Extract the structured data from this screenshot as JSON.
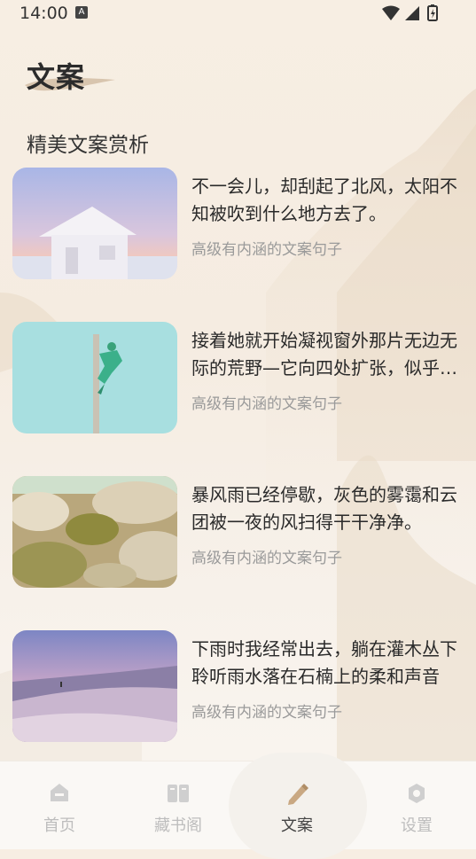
{
  "status_bar": {
    "time": "14:00"
  },
  "header": {
    "title": "文案"
  },
  "section": {
    "heading": "精美文案赏析"
  },
  "items": [
    {
      "title": "不一会儿，却刮起了北风，太阳不知被吹到什么地方去了。",
      "subtitle": "高级有内涵的文案句子",
      "image": "frozen-house-photo"
    },
    {
      "title": "接着她就开始凝视窗外那片无边无际的荒野—它向四处扩张，似乎无穷无尽",
      "subtitle": "高级有内涵的文案句子",
      "image": "pole-climber-photo"
    },
    {
      "title": "暴风雨已经停歇，灰色的雾霭和云团被一夜的风扫得干干净净。",
      "subtitle": "高级有内涵的文案句子",
      "image": "rocky-desert-photo"
    },
    {
      "title": "下雨时我经常出去，躺在灌木丛下聆听雨水落在石楠上的柔和声音",
      "subtitle": "高级有内涵的文案句子",
      "image": "sand-dune-photo"
    }
  ],
  "bottom_nav": {
    "items": [
      {
        "label": "首页",
        "icon": "home-icon",
        "active": false
      },
      {
        "label": "藏书阁",
        "icon": "book-icon",
        "active": false
      },
      {
        "label": "文案",
        "icon": "pen-icon",
        "active": true
      },
      {
        "label": "设置",
        "icon": "settings-icon",
        "active": false
      }
    ]
  },
  "colors": {
    "background": "#f6ede2",
    "inactive_nav": "#bdbdbd",
    "active_nav": "#444444",
    "subtitle": "#9a9a9a"
  }
}
